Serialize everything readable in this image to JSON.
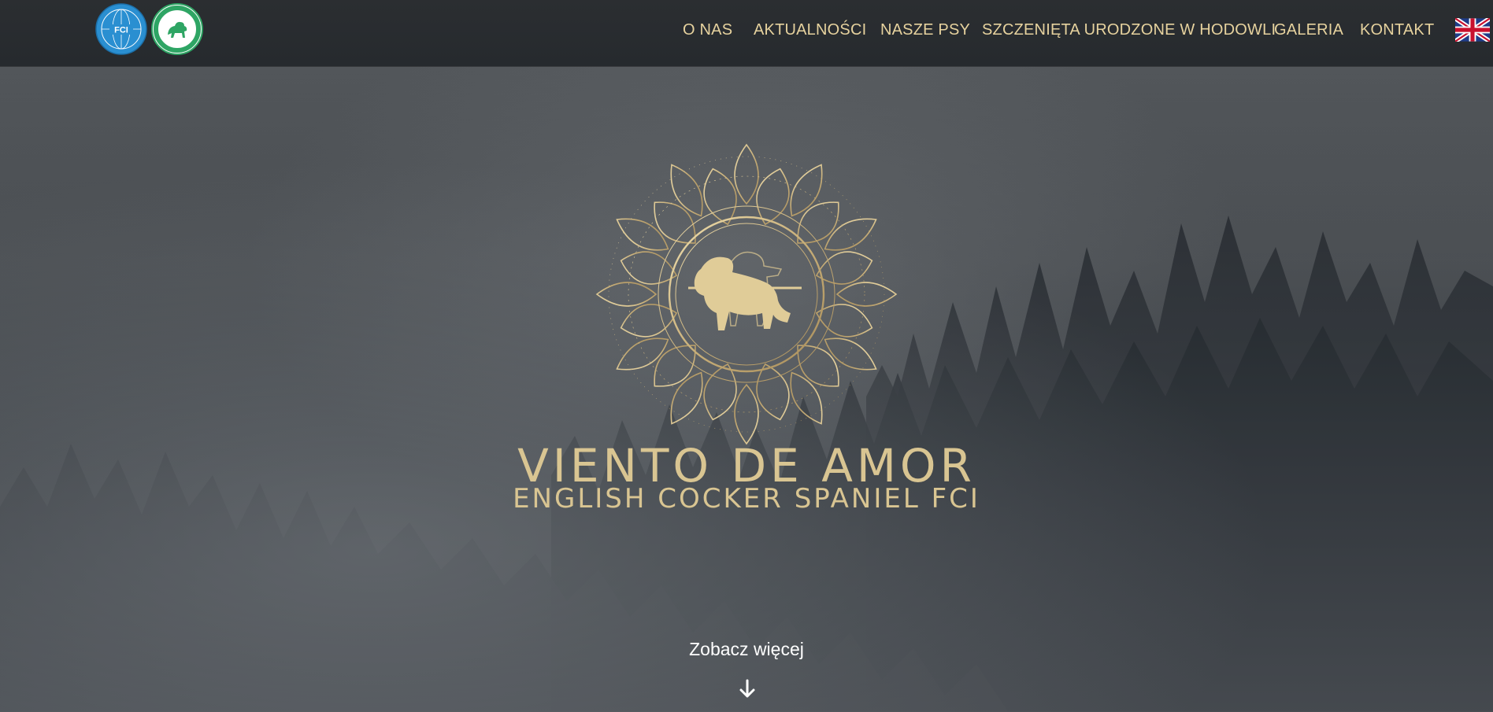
{
  "header": {
    "logos": [
      {
        "name": "fci-logo",
        "text": "FCI"
      },
      {
        "name": "zkwp-logo",
        "text": ""
      }
    ],
    "nav": [
      {
        "label": "O NAS"
      },
      {
        "label": "AKTUALNOŚCI"
      },
      {
        "label": "NASZE PSY"
      },
      {
        "label": "SZCZENIĘTA URODZONE W HODOWLI"
      },
      {
        "label": "GALERIA"
      },
      {
        "label": "KONTAKT"
      }
    ],
    "language_flag": "uk-flag-icon"
  },
  "hero": {
    "emblem_icon": "mandala-dog-emblem",
    "title": "VIENTO DE AMOR",
    "subtitle": "ENGLISH COCKER SPANIEL FCI",
    "see_more": "Zobacz więcej",
    "scroll_icon": "arrow-down-icon"
  },
  "colors": {
    "header_bg": "#2a2d30",
    "nav_text": "#e6d29e",
    "gold": "#d9c592",
    "see_more_text": "#ffffff"
  }
}
